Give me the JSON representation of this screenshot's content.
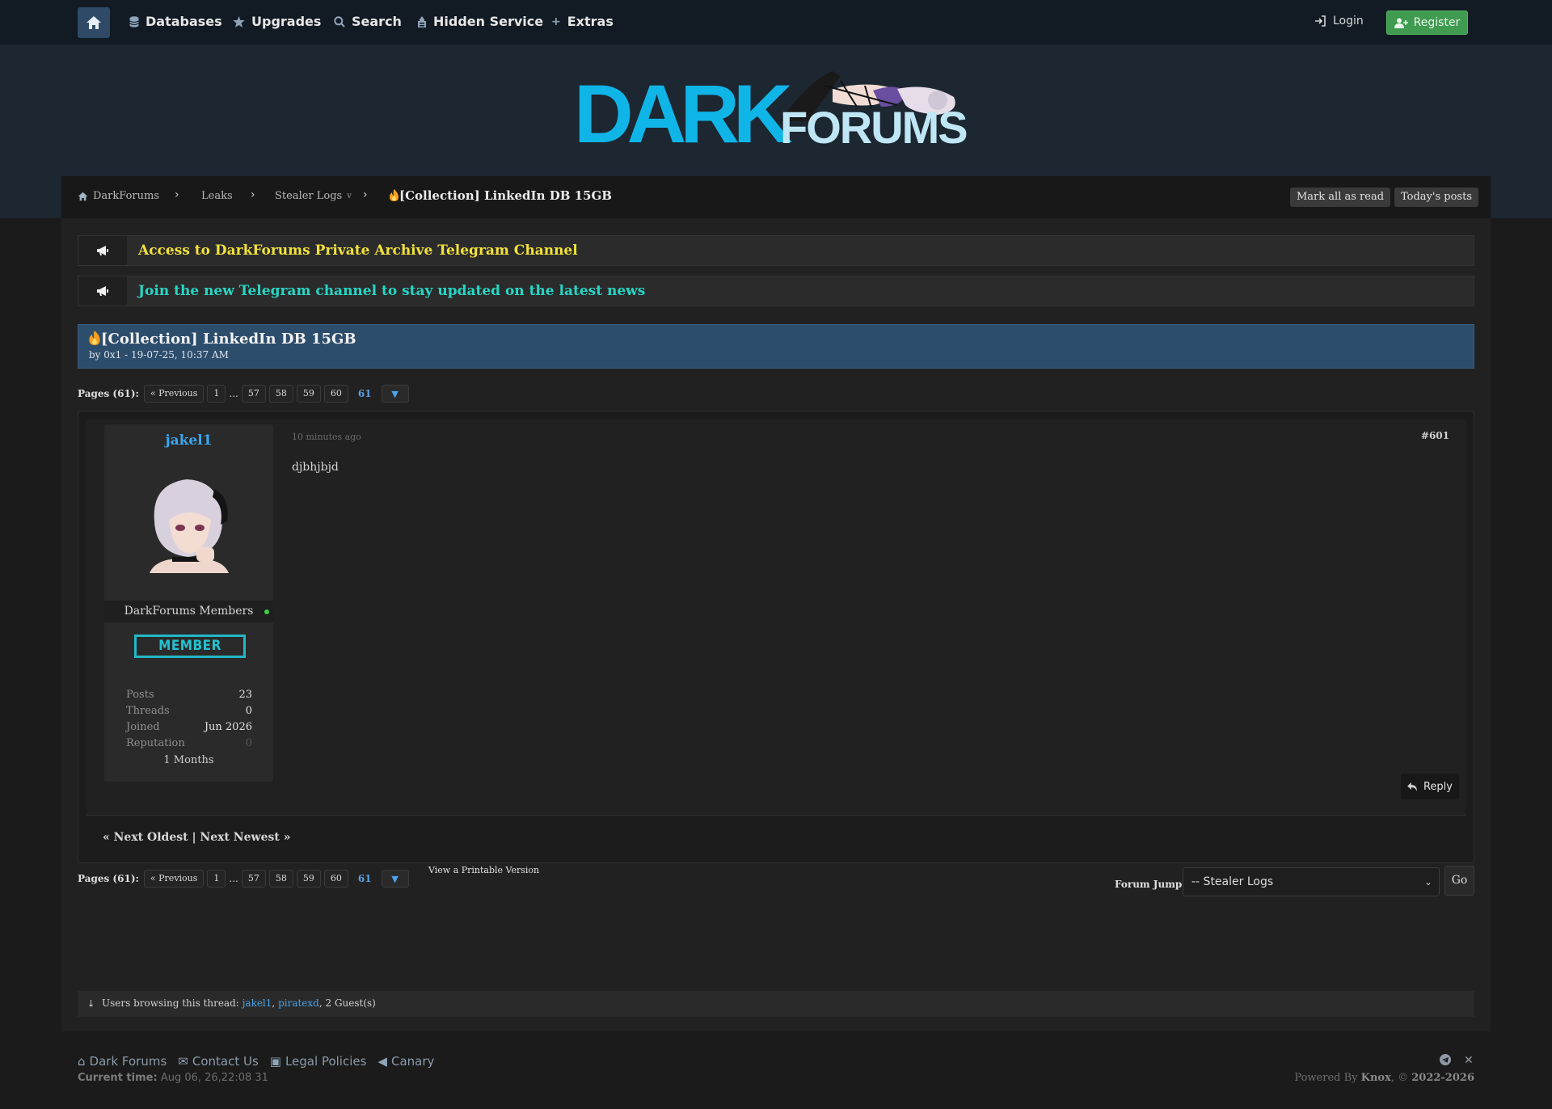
{
  "nav": {
    "items": [
      {
        "label": "Databases",
        "icon": "database-icon"
      },
      {
        "label": "Upgrades",
        "icon": "star-icon"
      },
      {
        "label": "Search",
        "icon": "search-icon"
      },
      {
        "label": "Hidden Service",
        "icon": "onion-icon"
      },
      {
        "label": "Extras",
        "icon": "plus-icon"
      }
    ],
    "login": "Login",
    "register": "Register"
  },
  "logo": {
    "part1": "DARK",
    "part2": "FORUMS"
  },
  "breadcrumb": {
    "items": [
      "DarkForums",
      "Leaks",
      "Stealer Logs"
    ],
    "current": "[Collection] LinkedIn DB 15GB",
    "mark_read": "Mark all as read",
    "todays_posts": "Today's posts"
  },
  "announcements": [
    {
      "text": "Access to DarkForums Private Archive Telegram Channel",
      "color": "#f2e23a"
    },
    {
      "text": "Join the new Telegram channel to stay updated on the latest news",
      "color": "#27d6c4"
    }
  ],
  "thread": {
    "title": "[Collection] LinkedIn DB 15GB",
    "meta": "by 0x1 - 19-07-25, 10:37 AM"
  },
  "pagination": {
    "label": "Pages (61):",
    "prev": "« Previous",
    "pages": [
      "1",
      "57",
      "58",
      "59",
      "60"
    ],
    "dots": "...",
    "current": "61"
  },
  "post": {
    "username": "jakel1",
    "group": "DarkForums Members",
    "badge": "MEMBER",
    "stats": [
      {
        "k": "Posts",
        "v": "23"
      },
      {
        "k": "Threads",
        "v": "0"
      },
      {
        "k": "Joined",
        "v": "Jun 2026"
      },
      {
        "k": "Reputation",
        "v": "0"
      }
    ],
    "member_age": "1 Months",
    "time": "10 minutes ago",
    "number": "#601",
    "body": "djbhjbjd",
    "reply": "Reply"
  },
  "next_links": "« Next Oldest | Next Newest »",
  "printable": "View a Printable Version",
  "forum_jump": {
    "label": "Forum Jump:",
    "selected": "-- Stealer Logs",
    "go": "Go"
  },
  "browsing": {
    "prefix": "Users browsing this thread:",
    "users": [
      "jakel1",
      "piratexd"
    ],
    "guests": "2 Guest(s)"
  },
  "footer": {
    "links": [
      "Dark Forums",
      "Contact Us",
      "Legal Policies",
      "Canary"
    ],
    "current_time_label": "Current time:",
    "current_time": "Aug 06, 26,22:08 31",
    "powered_prefix": "Powered By",
    "powered_by": "Knox",
    "copyright": "2022-2026"
  }
}
